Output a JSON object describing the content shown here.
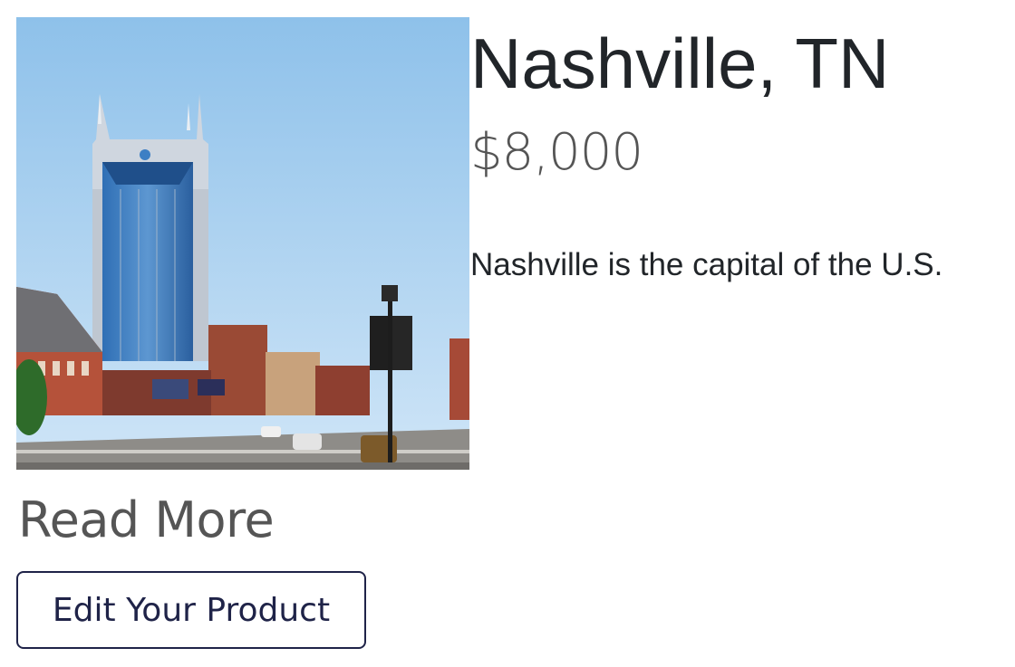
{
  "product": {
    "title": "Nashville, TN",
    "price": "$8,000",
    "description": "Nashville is the capital of the U.S.",
    "image_alt": "Nashville skyline with AT&T building"
  },
  "actions": {
    "read_more_label": "Read More",
    "edit_label": "Edit Your Product"
  },
  "colors": {
    "button_border": "#1f2348",
    "price_text": "#555555",
    "sky": "#a7cef0"
  }
}
